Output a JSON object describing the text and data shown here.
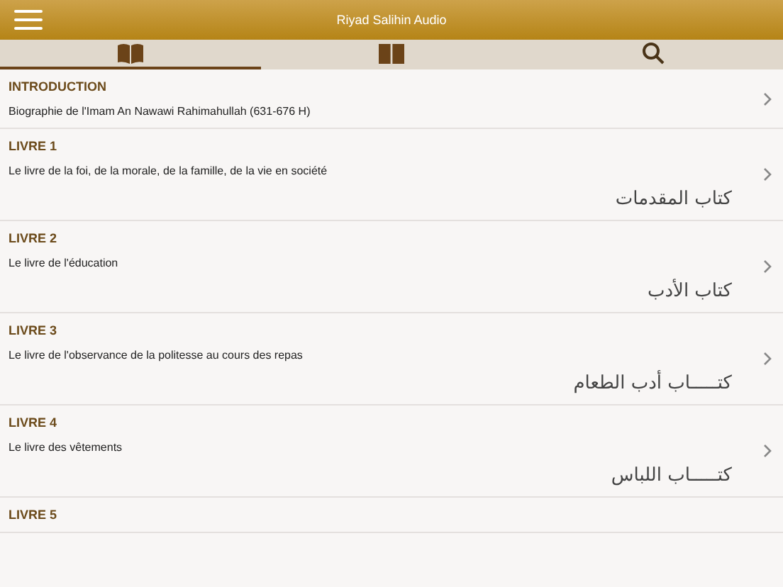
{
  "header": {
    "title": "Riyad Salihin Audio"
  },
  "tabs": [
    {
      "kind": "reader",
      "selected": true
    },
    {
      "kind": "book",
      "selected": false
    },
    {
      "kind": "search",
      "selected": false
    }
  ],
  "sections": [
    {
      "title": "INTRODUCTION",
      "subtitle": "Biographie de l'Imam An Nawawi Rahimahullah (631-676 H)"
    },
    {
      "title": "LIVRE 1",
      "subtitle": "Le livre de la foi, de la morale, de la famille, de la vie en société",
      "arabic": "كتاب المقدمات"
    },
    {
      "title": "LIVRE 2",
      "subtitle": "Le livre de l'éducation",
      "arabic": "كتاب الأدب"
    },
    {
      "title": "LIVRE 3",
      "subtitle": "Le livre de l'observance de la politesse au cours des repas",
      "arabic": "كتـــــاب أدب الطعام"
    },
    {
      "title": "LIVRE 4",
      "subtitle": "Le livre des vêtements",
      "arabic": "كتـــــاب اللباس"
    },
    {
      "title": "LIVRE 5"
    }
  ]
}
